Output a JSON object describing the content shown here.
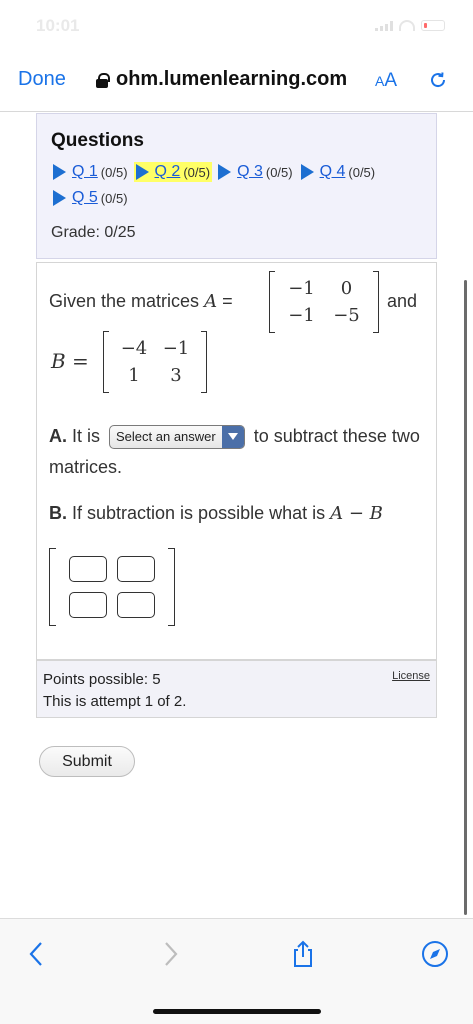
{
  "status": {
    "time": "10:01"
  },
  "nav": {
    "done_label": "Done",
    "url": "ohm.lumenlearning.com",
    "aa_small": "A",
    "aa_large": "A"
  },
  "questions": {
    "heading": "Questions",
    "items": [
      {
        "label": "Q 1",
        "score": "(0/5)"
      },
      {
        "label": "Q 2",
        "score": "(0/5)"
      },
      {
        "label": "Q 3",
        "score": "(0/5)"
      },
      {
        "label": "Q 4",
        "score": "(0/5)"
      },
      {
        "label": "Q 5",
        "score": "(0/5)"
      }
    ],
    "current_index": 1,
    "grade": "Grade: 0/25"
  },
  "problem": {
    "given_prefix": "Given the matrices ",
    "a_symbol": "A",
    "equals": " =",
    "matrix_a": [
      [
        "−1",
        "0"
      ],
      [
        "−1",
        "−5"
      ]
    ],
    "and_text": "and",
    "b_symbol": "B",
    "matrix_b": [
      [
        "−4",
        "−1"
      ],
      [
        "1",
        "3"
      ]
    ],
    "part_a_label": "A.",
    "part_a_prefix": " It is ",
    "select_value": "Select an answer",
    "part_a_suffix": " to subtract these two matrices.",
    "part_b_label": "B.",
    "part_b_text": " If subtraction is possible what is ",
    "part_b_expr": "A − B"
  },
  "footer": {
    "points": "Points possible: 5",
    "attempt": "This is attempt 1 of 2.",
    "license": "License"
  },
  "submit_label": "Submit",
  "colors": {
    "link": "#1a5cd7",
    "accent": "#1a73e8",
    "highlight": "#ffff66",
    "panel": "#f2f2fb"
  }
}
